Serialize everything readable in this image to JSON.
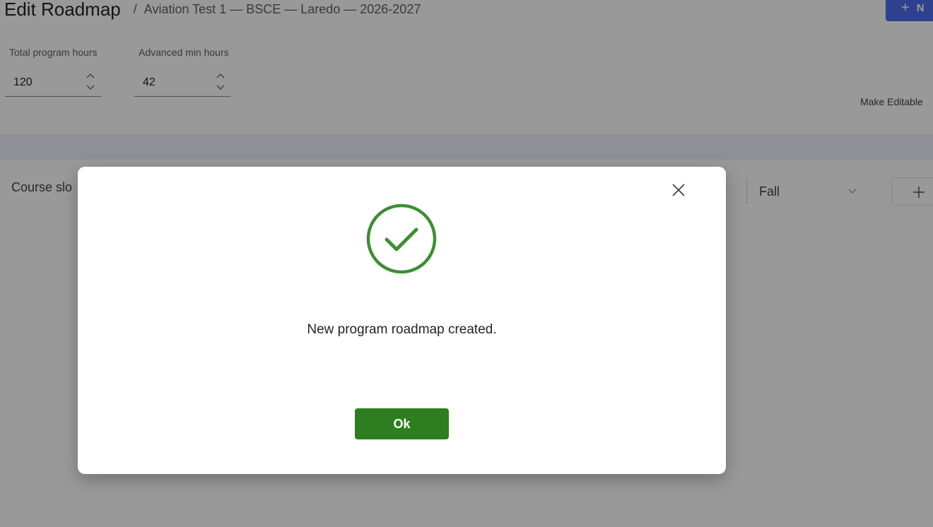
{
  "header": {
    "title": "Edit Roadmap",
    "separator": "/",
    "breadcrumb": "Aviation Test 1 — BSCE — Laredo — 2026-2027",
    "new_button_label": "N"
  },
  "fields": {
    "total_hours": {
      "label": "Total program hours",
      "value": "120"
    },
    "advanced_min_hours": {
      "label": "Advanced min hours",
      "value": "42"
    }
  },
  "make_editable_label": "Make Editable",
  "course_slots_label": "Course slo",
  "term_select": {
    "value": "Fall"
  },
  "dialog": {
    "message": "New program roadmap created.",
    "ok_label": "Ok",
    "icon": "check-circle-icon",
    "close_icon": "close-icon"
  },
  "colors": {
    "success": "#3e8e35",
    "ok_button": "#2e7d1f",
    "primary_button": "#4f6bed"
  }
}
